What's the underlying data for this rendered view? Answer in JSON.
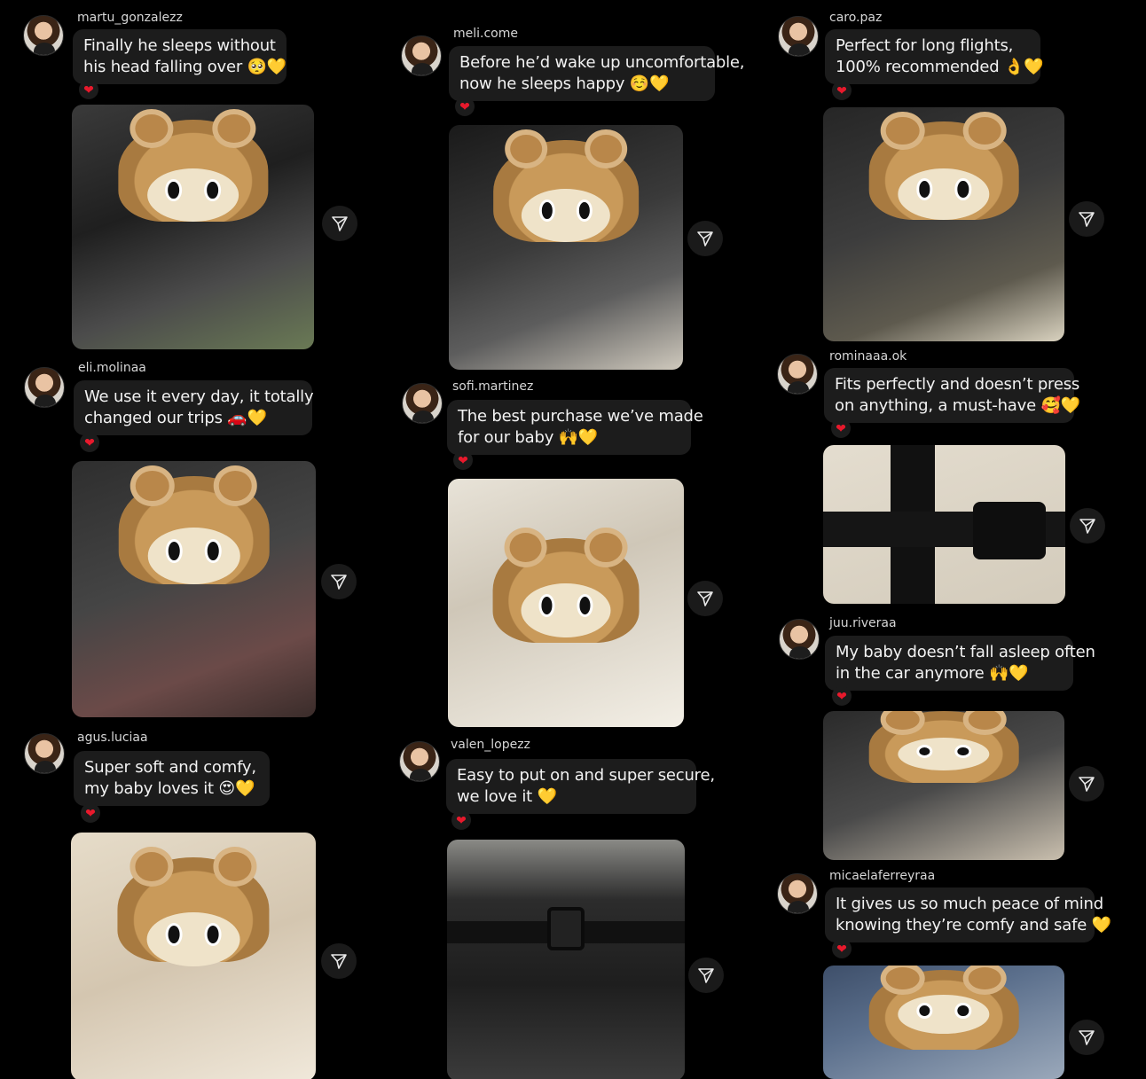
{
  "posts": [
    {
      "username": "martu_gonzalezz",
      "lines": [
        "Finally he sleeps without",
        "his head falling over 🥺💛"
      ],
      "heart": "❤"
    },
    {
      "username": "eli.molinaa",
      "lines": [
        "We use it every day, it totally",
        "changed our trips 🚗💛"
      ],
      "heart": "❤"
    },
    {
      "username": "agus.luciaa",
      "lines": [
        "Super soft and comfy,",
        "my baby loves it 😍💛"
      ],
      "heart": "❤"
    },
    {
      "username": "meli.come",
      "lines": [
        "Before he’d wake up uncomfortable,",
        "now he sleeps happy ☺️💛"
      ],
      "heart": "❤"
    },
    {
      "username": "sofi.martinez",
      "lines": [
        "The best purchase we’ve made",
        "for our baby 🙌💛"
      ],
      "heart": "❤"
    },
    {
      "username": "valen_lopezz",
      "lines": [
        "Easy to put on and super secure,",
        "we love it 💛"
      ],
      "heart": "❤"
    },
    {
      "username": "caro.paz",
      "lines": [
        "Perfect for long flights,",
        "100% recommended 👌💛"
      ],
      "heart": "❤"
    },
    {
      "username": "rominaaa.ok",
      "lines": [
        "Fits perfectly and doesn’t press",
        "on anything, a must-have 🥰💛"
      ],
      "heart": "❤"
    },
    {
      "username": "juu.riveraa",
      "lines": [
        "My baby doesn’t fall asleep often",
        "in the car anymore 🙌💛"
      ],
      "heart": "❤"
    },
    {
      "username": "micaelaferreyraa",
      "lines": [
        "It gives us so much peace of mind",
        "knowing they’re comfy and safe 💛"
      ],
      "heart": "❤"
    }
  ],
  "icons": {
    "share": "send-icon",
    "reaction": "heart-icon",
    "profile": "avatar"
  },
  "colors": {
    "background": "#000000",
    "bubble": "#1c1c1c",
    "heart": "#e8192c",
    "username": "#d6d6d6"
  }
}
